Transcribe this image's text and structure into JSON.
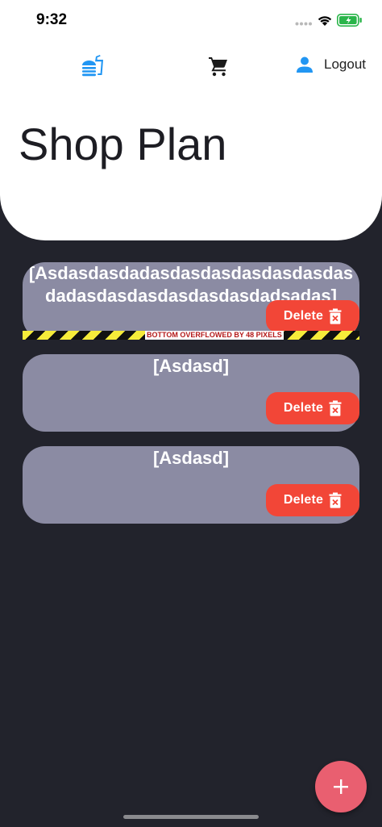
{
  "status_bar": {
    "time": "9:32"
  },
  "nav": {
    "logout_label": "Logout"
  },
  "page": {
    "title": "Shop Plan"
  },
  "plans": [
    {
      "title": "[Asdasdasdadasdasdasdasdasdasdasdadasdasdasdasdasdasdadsadas]",
      "delete_label": "Delete"
    },
    {
      "title": "[Asdasd]",
      "delete_label": "Delete"
    },
    {
      "title": "[Asdasd]",
      "delete_label": "Delete"
    }
  ],
  "overflow_warning": "BOTTOM OVERFLOWED BY 48 PIXELS",
  "colors": {
    "background": "#22232c",
    "card": "#8b8ba3",
    "delete": "#f24637",
    "fab": "#e95f70",
    "accent": "#2196f3"
  },
  "icons": {
    "nav_menu": "fastfood-icon",
    "nav_cart": "cart-icon",
    "nav_person": "person-icon",
    "delete": "trash-icon",
    "fab": "plus-icon"
  }
}
